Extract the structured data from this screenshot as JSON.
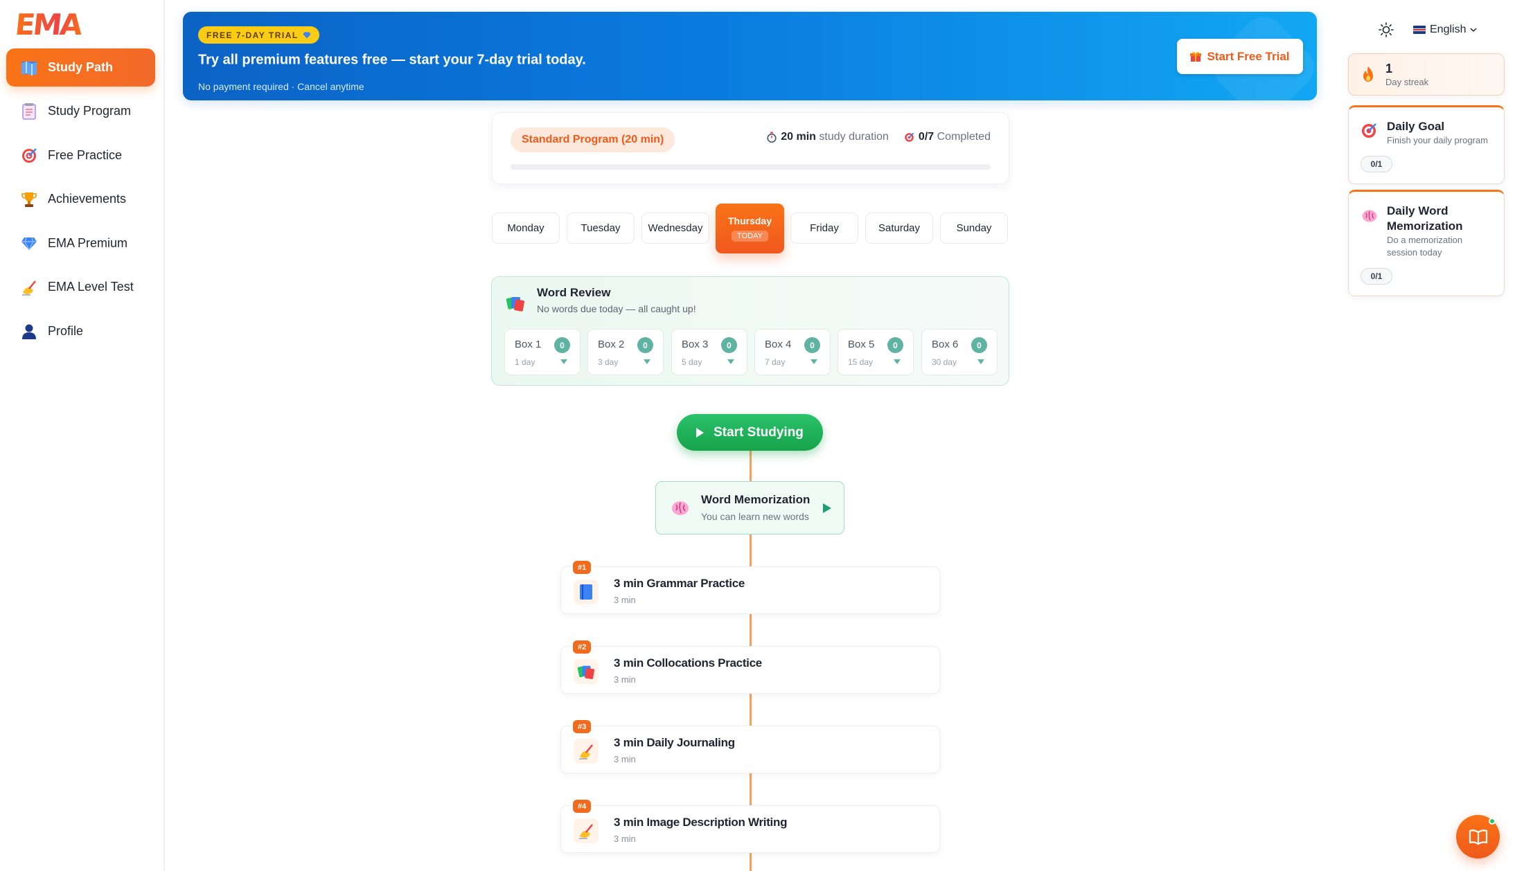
{
  "brand": {
    "logo_text": "EMA"
  },
  "sidebar": {
    "items": [
      {
        "label": "Study Path",
        "icon": "map-icon",
        "active": true
      },
      {
        "label": "Study Program",
        "icon": "notepad-icon",
        "active": false
      },
      {
        "label": "Free Practice",
        "icon": "target-icon",
        "active": false
      },
      {
        "label": "Achievements",
        "icon": "trophy-icon",
        "active": false
      },
      {
        "label": "EMA Premium",
        "icon": "diamond-icon",
        "active": false
      },
      {
        "label": "EMA Level Test",
        "icon": "writing-hand-icon",
        "active": false
      },
      {
        "label": "Profile",
        "icon": "user-icon",
        "active": false
      }
    ]
  },
  "banner": {
    "pill": "FREE 7-DAY TRIAL",
    "headline": "Try all premium features free — start your 7-day trial today.",
    "subline": "No payment required · Cancel anytime",
    "cta": "Start Free Trial"
  },
  "program": {
    "name": "Standard Program (20 min)",
    "duration_value": "20 min",
    "duration_label": "study duration",
    "completed_value": "0/7",
    "completed_label": "Completed",
    "progress": 0
  },
  "days": {
    "items": [
      "Monday",
      "Tuesday",
      "Wednesday",
      "Thursday",
      "Friday",
      "Saturday",
      "Sunday"
    ],
    "today_index": 3,
    "today_badge": "TODAY"
  },
  "word_review": {
    "title": "Word Review",
    "subtitle": "No words due today — all caught up!",
    "boxes": [
      {
        "label": "Box 1",
        "interval": "1 day",
        "count": "0"
      },
      {
        "label": "Box 2",
        "interval": "3 day",
        "count": "0"
      },
      {
        "label": "Box 3",
        "interval": "5 day",
        "count": "0"
      },
      {
        "label": "Box 4",
        "interval": "7 day",
        "count": "0"
      },
      {
        "label": "Box 5",
        "interval": "15 day",
        "count": "0"
      },
      {
        "label": "Box 6",
        "interval": "30 day",
        "count": "0"
      }
    ]
  },
  "start_button": "Start Studying",
  "memorization": {
    "title": "Word Memorization",
    "subtitle": "You can learn new words"
  },
  "lessons": [
    {
      "num": "#1",
      "title": "3 min Grammar Practice",
      "duration": "3 min",
      "icon": "book-icon"
    },
    {
      "num": "#2",
      "title": "3 min Collocations Practice",
      "duration": "3 min",
      "icon": "cards-icon"
    },
    {
      "num": "#3",
      "title": "3 min Daily Journaling",
      "duration": "3 min",
      "icon": "writing-hand-icon"
    },
    {
      "num": "#4",
      "title": "3 min Image Description Writing",
      "duration": "3 min",
      "icon": "writing-hand-icon"
    }
  ],
  "topbar": {
    "language": "English"
  },
  "streak": {
    "value": "1",
    "label": "Day streak"
  },
  "daily_goal": {
    "title": "Daily Goal",
    "subtitle": "Finish your daily program",
    "count": "0/1"
  },
  "daily_memo": {
    "title": "Daily Word Memorization",
    "subtitle": "Do a memorization session today",
    "count": "0/1"
  },
  "colors": {
    "accent": "#f97316",
    "banner": "#0a7ae0",
    "success": "#16a34a",
    "teal": "#5fb3a3"
  }
}
